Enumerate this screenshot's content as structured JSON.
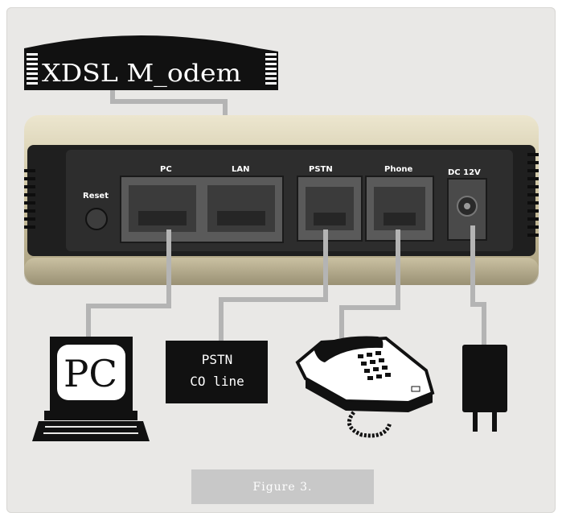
{
  "banner": {
    "title": "XDSL M_odem"
  },
  "ports": {
    "reset": "Reset",
    "pc": "PC",
    "lan": "LAN",
    "pstn": "PSTN",
    "phone": "Phone",
    "dc": "DC 12V"
  },
  "devices": {
    "pc_screen": "PC",
    "pstn_line1": "PSTN",
    "pstn_line2": "CO line"
  },
  "caption": "Figure 3.",
  "colors": {
    "panel": "#e9e8e6",
    "modem_shell": "#cfc6a8",
    "modem_face": "#2a2a2a",
    "cable": "#b4b4b4",
    "device": "#111111"
  }
}
